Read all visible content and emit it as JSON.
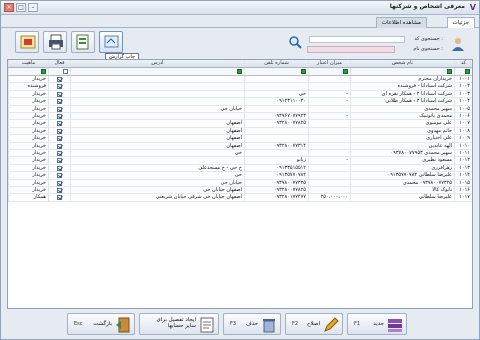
{
  "window": {
    "title": "معرفی اشخاص و شرکتها"
  },
  "tabs": [
    {
      "label": "جزئیات"
    },
    {
      "label": "مشاهده اطلاعات"
    }
  ],
  "toolbar": {
    "tooltip": "چاپ گزارش"
  },
  "search": {
    "code_label": "جستجوی کد :",
    "name_label": "جستجوی نام :"
  },
  "columns": {
    "code": "کد",
    "name": "نام شخص",
    "credit": "میزان اعتبار",
    "phone": "شماره تلفن",
    "address": "آدرس",
    "active": "فعال",
    "role": "ماهیت"
  },
  "rows": [
    {
      "code": "۱۰۰۱",
      "name": "خریداران محترم",
      "credit": "",
      "phone": "",
      "address": "",
      "active": true,
      "role": "خریدار"
    },
    {
      "code": "۱۰۰۲",
      "name": "شرکت اسپادانا - فروشنده",
      "credit": "",
      "phone": "",
      "address": "",
      "active": true,
      "role": "فروشنده"
    },
    {
      "code": "۱۰۰۳",
      "name": "شرکت اسپادانا ۲ - همکار نقره ای",
      "credit": "-",
      "phone": "خی",
      "address": "",
      "active": true,
      "role": "خریدار"
    },
    {
      "code": "۱۰۰۴",
      "name": "شرکت اسپادانا ۳ - همکار طلایی",
      "credit": "-",
      "phone": "۰۹۱۲۳۱۱۰۰۳۰",
      "address": "",
      "active": true,
      "role": "خریدار"
    },
    {
      "code": "۱۰۰۵",
      "name": "سهیر محمدی",
      "credit": "",
      "phone": "",
      "address": "خیابان خی",
      "active": true,
      "role": "خریدار"
    },
    {
      "code": "۱۰۰۶",
      "name": "محمدی باتوتنیک",
      "credit": "-",
      "phone": "۰۹۳۷۶۷۰۷۷۹۲۳",
      "address": "",
      "active": true,
      "role": "خریدار"
    },
    {
      "code": "۱۰۰۷",
      "name": "علی موسوی",
      "credit": "",
      "phone": "۰۹۳۲۸۰۰۷۷۸۲۵",
      "address": "اصفهان",
      "active": true,
      "role": "خریدار"
    },
    {
      "code": "۱۰۰۸",
      "name": "خانم مهدوی",
      "credit": "",
      "phone": "",
      "address": "اصفهان",
      "active": true,
      "role": "خریدار"
    },
    {
      "code": "۱۰۰۹",
      "name": "علی اختیاری",
      "credit": "",
      "phone": "",
      "address": "اصفهان",
      "active": true,
      "role": "خریدار"
    },
    {
      "code": "۱۰۱۰",
      "name": "الهه عابدین",
      "credit": "",
      "phone": "۰۹۳۲۸۰۰۷۷۳۱۴",
      "address": "اصفهان",
      "active": true,
      "role": "خریدار"
    },
    {
      "code": "۱۰۱۱",
      "name": "سهیر محمدی ۰۹۳۷۸۰۰۷۷۹۵۳",
      "credit": "",
      "phone": "",
      "address": "خی",
      "active": true,
      "role": "خریدار"
    },
    {
      "code": "۱۰۱۲",
      "name": "مسعود نظیری",
      "credit": "-",
      "phone": "زیانو",
      "address": "",
      "active": true,
      "role": "خریدار"
    },
    {
      "code": "۱۰۱۳",
      "name": "زهرافرزی",
      "credit": "",
      "phone": "۰۹۱۳۳۵۱۵۵۱۲",
      "address": "خ خی - خ مسجدعلی",
      "active": true,
      "role": "خریدار"
    },
    {
      "code": "۱۰۱۴",
      "name": "علیرضا سلطانی ۰۹۱۳۵۷۷۰۷۸۲",
      "credit": "",
      "phone": "۰۹۱۳۵۷۷۰۷۸۲",
      "address": "خی",
      "active": true,
      "role": "خریدار"
    },
    {
      "code": "۱۰۱۵",
      "name": "۰۹۳۷۸۰۰۷۷۳۲۵ محمدی",
      "credit": "",
      "phone": "۰۹۳۷۸۰۰۷۷۳۲۵",
      "address": "خیابان خی",
      "active": true,
      "role": "خریدار"
    },
    {
      "code": "۱۰۱۶",
      "name": "نانوک کالا",
      "credit": "",
      "phone": "۰۹۳۲۸۰۰۷۷۸۲۵",
      "address": "اصفهان خیابان خی",
      "active": true,
      "role": "خریدار"
    },
    {
      "code": "۱۰۱۷",
      "name": "علیرضا سلطانی",
      "credit": "۲۵۰،۰۰۰،۰۰۰",
      "phone": "۰۹۳۲۸۰۱۷۷۴۷۷",
      "address": "اصفهان خیابان خی شرقی خیابان شریعتی",
      "active": true,
      "role": "همکار"
    }
  ],
  "bottom": {
    "new": {
      "label": "جدید",
      "key": "F1"
    },
    "edit": {
      "label": "اصلاح",
      "key": "F2"
    },
    "delete": {
      "label": "حذف",
      "key": "F3"
    },
    "make_detail": {
      "label": "ایجاد تفصیل برای سایر حسابها"
    },
    "back": {
      "label": "بازگشت",
      "key": "Esc"
    }
  }
}
